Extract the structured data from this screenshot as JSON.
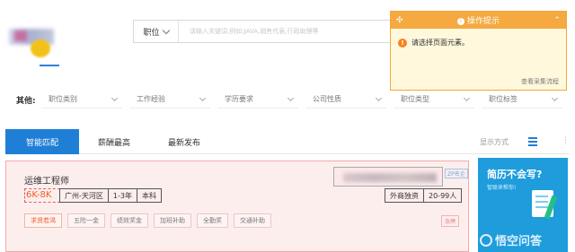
{
  "search": {
    "type_label": "职位",
    "placeholder": "请输入关键词,例如:JAVA,销售代表,行政助理等"
  },
  "tip": {
    "title": "操作提示",
    "message": "请选择页面元素。",
    "link": "查看采集流程"
  },
  "filters": {
    "label": "其他:",
    "items": [
      "职位类别",
      "工作经验",
      "学历要求",
      "公司性质",
      "职位类型",
      "职位标签"
    ]
  },
  "tabs": {
    "items": [
      "智能匹配",
      "薪酬最高",
      "最新发布"
    ],
    "active": "智能匹配",
    "show_mode": "显示方式"
  },
  "job": {
    "title": "运维工程师",
    "salary": "6K-8K",
    "location": "广州-天河区",
    "experience": "1-3年",
    "education": "本科",
    "zp_badge": "ZP名企",
    "company_type": "外商独资",
    "company_size": "20-99人",
    "welfare": [
      "求贤若渴",
      "五险一金",
      "绩效奖金",
      "加班补助",
      "全勤奖",
      "交通补助"
    ],
    "quick_tag": "急聘"
  },
  "ad": {
    "title": "简历不会写?",
    "subtitle": "智联来帮你!",
    "watermark": "悟空问答"
  }
}
